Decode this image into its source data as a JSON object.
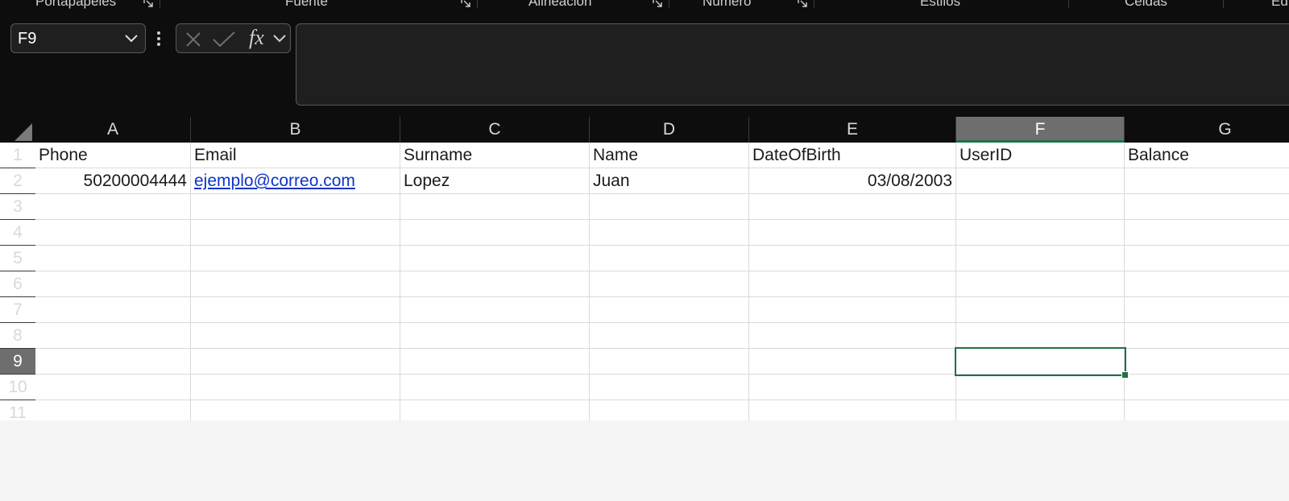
{
  "ribbon": {
    "groups": [
      {
        "label": "Portapapeles"
      },
      {
        "label": "Fuente"
      },
      {
        "label": "Alineación"
      },
      {
        "label": "Número"
      },
      {
        "label": "Estilos"
      },
      {
        "label": "Celdas"
      },
      {
        "label": "Ed"
      }
    ]
  },
  "formula_bar": {
    "name_box": "F9",
    "fx_label": "fx",
    "content": ""
  },
  "sheet": {
    "columns": [
      "A",
      "B",
      "C",
      "D",
      "E",
      "F",
      "G"
    ],
    "rows": [
      "1",
      "2",
      "3",
      "4",
      "5",
      "6",
      "7",
      "8",
      "9",
      "10",
      "11"
    ],
    "active_cell": "F9",
    "cells": [
      [
        "Phone",
        "Email",
        "Surname",
        "Name",
        "DateOfBirth",
        "UserID",
        "Balance"
      ],
      [
        "50200004444",
        "ejemplo@correo.com",
        "Lopez",
        "Juan",
        "03/08/2003",
        "",
        ""
      ]
    ]
  },
  "colors": {
    "selection": "#1e7145",
    "hyperlink": "#0b35c7",
    "header_bg": "#0d0d0d",
    "selected_header_bg": "#6e6e6e"
  }
}
